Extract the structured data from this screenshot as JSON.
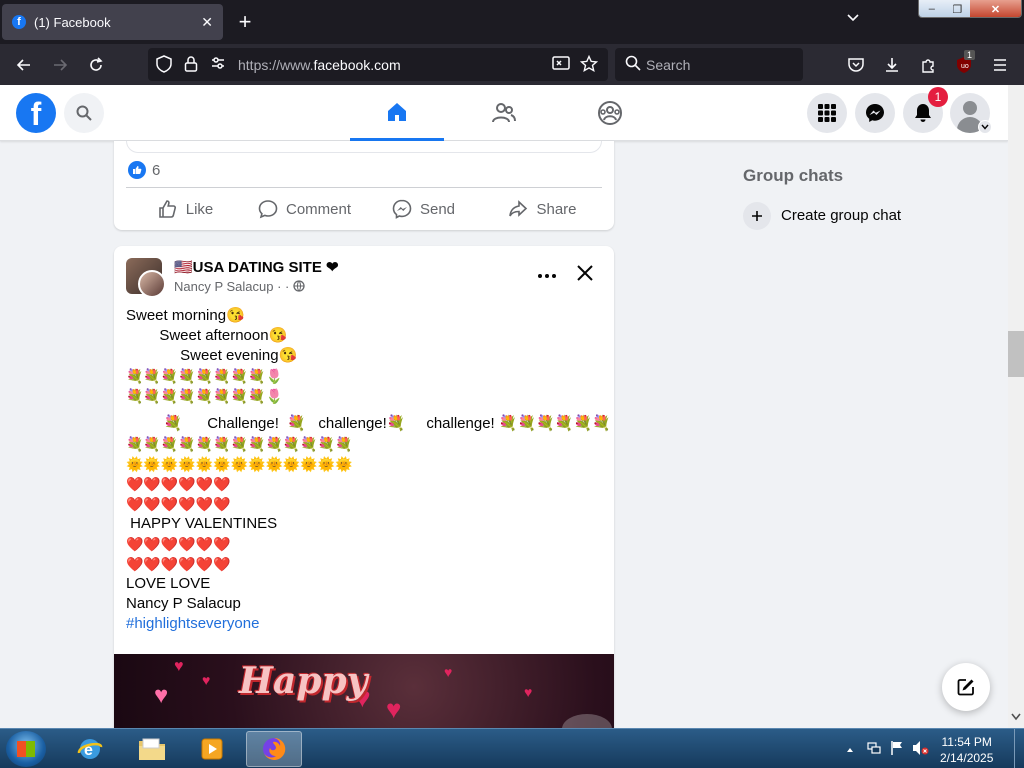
{
  "browser": {
    "tab": {
      "title": "(1) Facebook",
      "close": "✕"
    },
    "new_tab": "+",
    "url_prefix": "https://www.",
    "url_domain": "facebook.com",
    "search_placeholder": "Search",
    "ext_badge": "1",
    "window_buttons": {
      "min": "–",
      "max": "❐",
      "close": "✕"
    }
  },
  "facebook": {
    "logo": "f",
    "notification_count": "1",
    "feed": {
      "post1": {
        "like_count": "6",
        "actions": [
          "Like",
          "Comment",
          "Send",
          "Share"
        ]
      },
      "post2": {
        "group_name": "🇺🇸USA DATING SITE ❤",
        "author": "Nancy P Salacup",
        "meta_sep": " ·              · ",
        "lines": [
          "Sweet morning😘",
          "        Sweet afternoon😘",
          "             Sweet evening😘",
          "💐💐💐💐💐💐💐💐🌷",
          "💐💐💐💐💐💐💐💐🌷",
          "         💐      Challenge!  💐   challenge!💐     challenge! 💐💐💐💐💐💐",
          "💐💐💐💐💐💐💐💐💐💐💐💐💐",
          "🌞🌞🌞🌞🌞🌞🌞🌞🌞🌞🌞🌞🌞",
          "❤️❤️❤️❤️❤️❤️",
          "❤️❤️❤️❤️❤️❤️",
          " HAPPY VALENTINES",
          "❤️❤️❤️❤️❤️❤️",
          "❤️❤️❤️❤️❤️❤️",
          "LOVE LOVE",
          "Nancy P Salacup"
        ],
        "hashtag": "#highlightseveryone",
        "image_text": "Happy"
      }
    },
    "right_column": {
      "group_chats_title": "Group chats",
      "create_group_chat": "Create group chat"
    }
  },
  "taskbar": {
    "time": "11:54 PM",
    "date": "2/14/2025"
  }
}
